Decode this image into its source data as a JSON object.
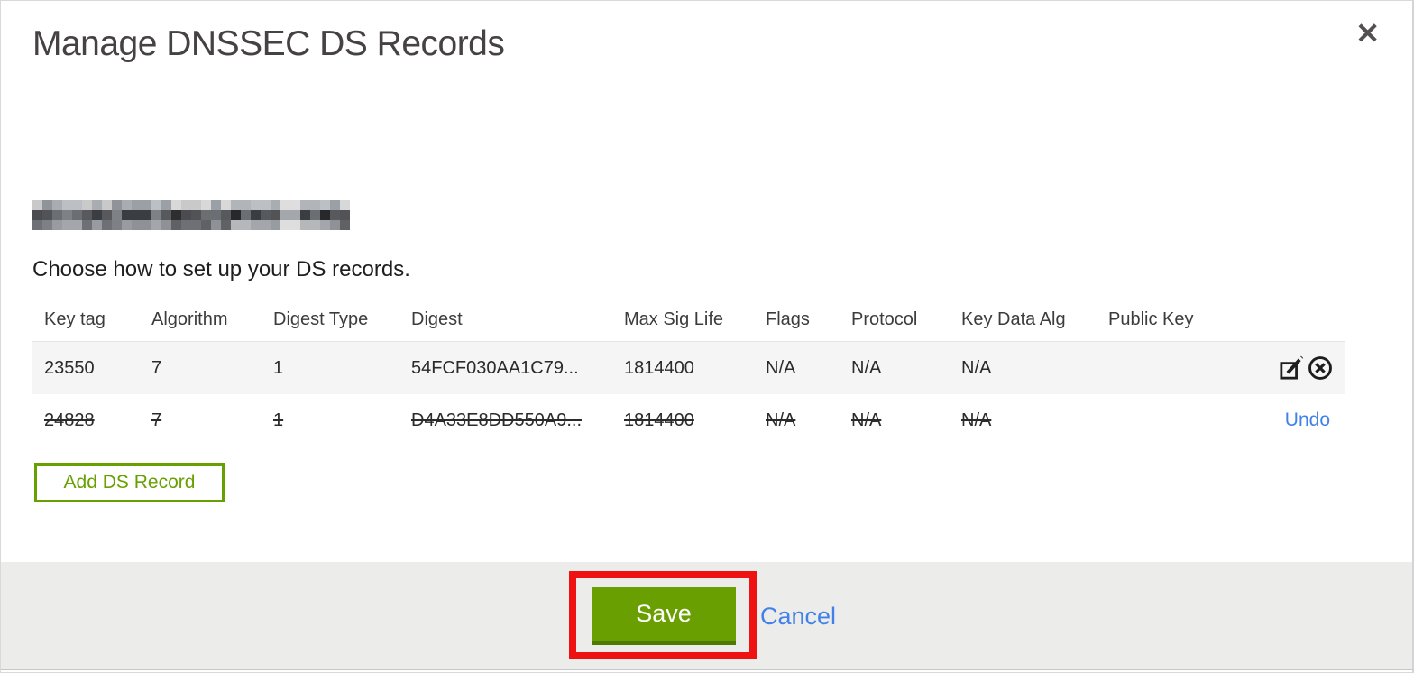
{
  "modal": {
    "title": "Manage DNSSEC DS Records",
    "close_icon": "✕",
    "instruction": "Choose how to set up your DS records.",
    "domain_redacted": true
  },
  "table": {
    "columns": [
      "Key tag",
      "Algorithm",
      "Digest Type",
      "Digest",
      "Max Sig Life",
      "Flags",
      "Protocol",
      "Key Data Alg",
      "Public Key"
    ],
    "rows": [
      {
        "key_tag": "23550",
        "algorithm": "7",
        "digest_type": "1",
        "digest": "54FCF030AA1C79...",
        "max_sig_life": "1814400",
        "flags": "N/A",
        "protocol": "N/A",
        "key_data_alg": "N/A",
        "public_key": "",
        "state": "normal",
        "actions": [
          "edit",
          "delete"
        ]
      },
      {
        "key_tag": "24828",
        "algorithm": "7",
        "digest_type": "1",
        "digest": "D4A33E8DD550A9...",
        "max_sig_life": "1814400",
        "flags": "N/A",
        "protocol": "N/A",
        "key_data_alg": "N/A",
        "public_key": "",
        "state": "deleted",
        "actions": [
          "undo"
        ]
      }
    ]
  },
  "buttons": {
    "add_ds_record": "Add DS Record",
    "save": "Save",
    "cancel": "Cancel",
    "undo": "Undo"
  },
  "icons": {
    "close": "x-mark",
    "edit": "pencil-square",
    "delete": "circle-x"
  },
  "colors": {
    "green": "#699f00",
    "green_dark": "#4e7a00",
    "link_blue": "#4082ea",
    "annotation_red": "#ee1212",
    "footer_bg": "#ececea",
    "row_alt_bg": "#f5f5f5"
  }
}
